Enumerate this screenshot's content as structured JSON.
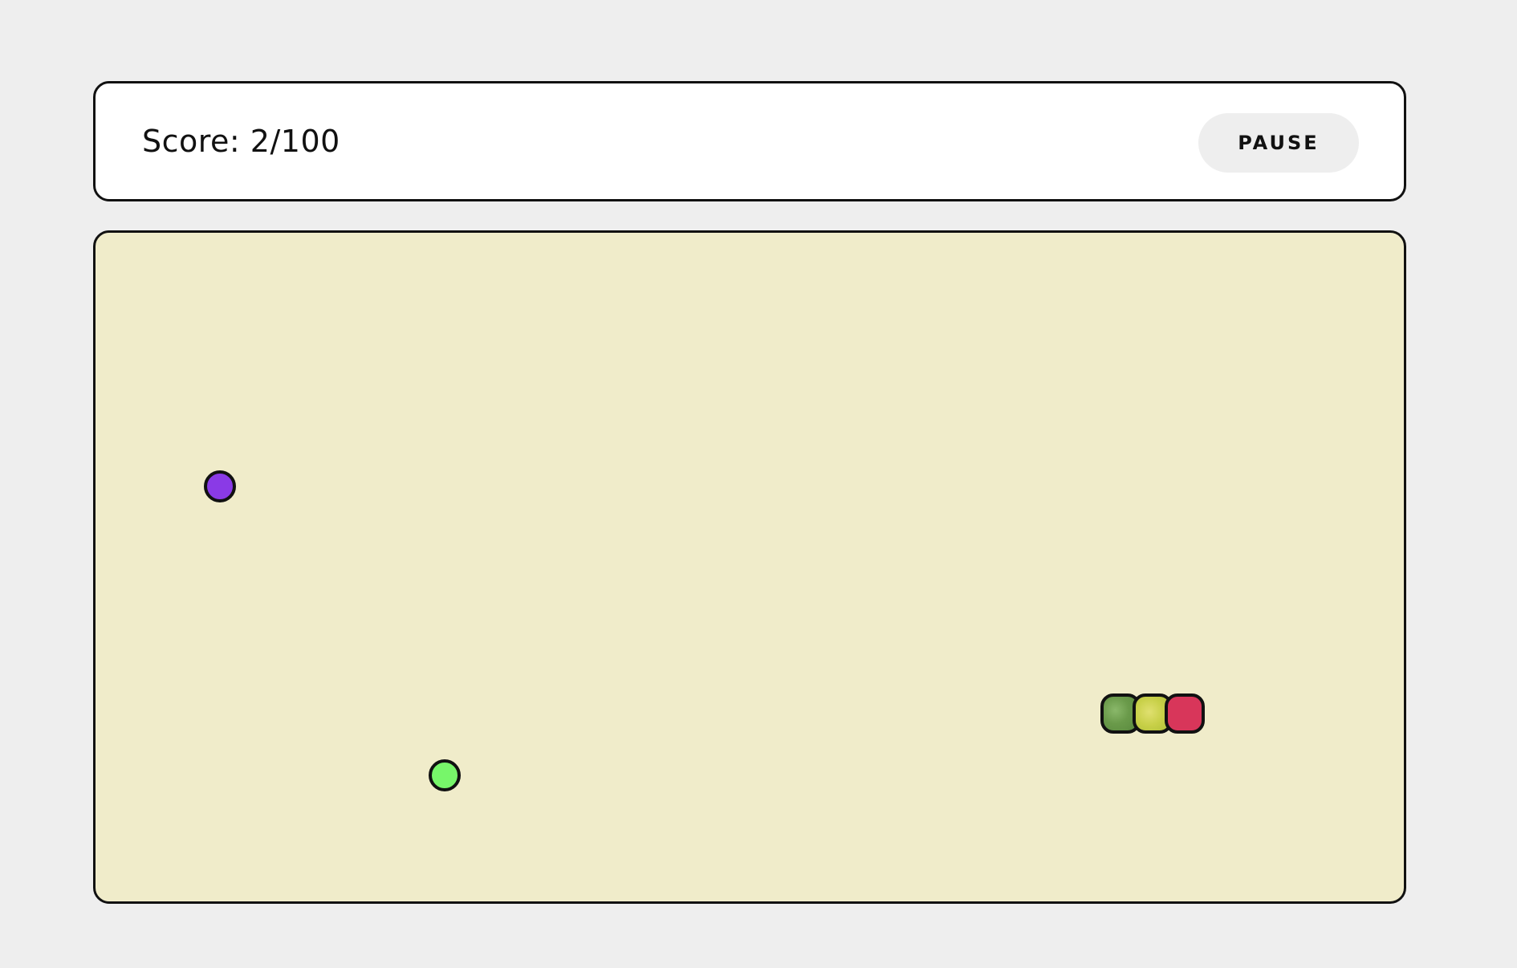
{
  "header": {
    "score_text": "Score: 2/100",
    "pause_label": "PAUSE"
  },
  "board": {
    "background": "#f0ecca"
  },
  "food": [
    {
      "name": "purple-food",
      "color": "#8a3ae6"
    },
    {
      "name": "green-food",
      "color": "#77f66a"
    }
  ],
  "snake": {
    "segments": [
      {
        "kind": "tail",
        "color": "#6a9a4a"
      },
      {
        "kind": "body",
        "color": "#c8d048"
      },
      {
        "kind": "head",
        "color": "#d8365a"
      }
    ]
  }
}
